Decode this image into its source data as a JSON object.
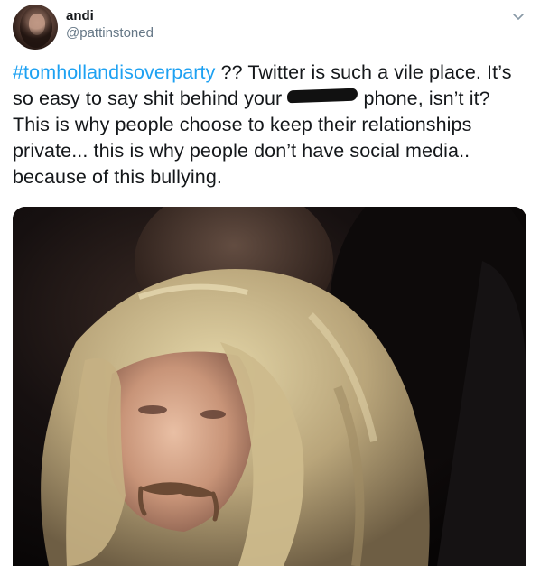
{
  "user": {
    "display_name": "andi",
    "handle": "@pattinstoned",
    "avatar_icon": "profile-photo"
  },
  "header": {
    "menu_icon": "chevron-down-icon"
  },
  "tweet": {
    "hashtag": "#tomhollandisoverparty",
    "text_before_censor": " ?? Twitter is such a vile place. It’s so easy to say shit behind your ",
    "text_after_censor": " phone, isn’t it? This is why people choose to keep their relationships private... this is why people don’t have social media.. because of this bullying."
  },
  "media": {
    "description_icon": "photo-attachment"
  },
  "colors": {
    "link": "#1da1f2",
    "text": "#14171a",
    "secondary": "#657786"
  }
}
